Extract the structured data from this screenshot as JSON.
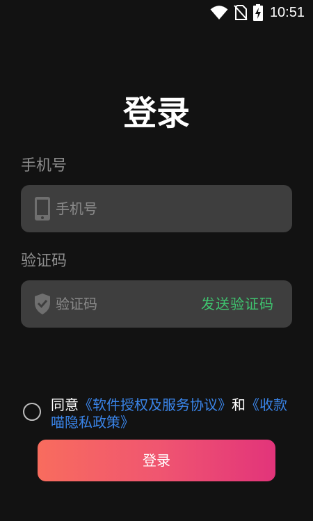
{
  "status_bar": {
    "time": "10:51",
    "icons": [
      "wifi-icon",
      "no-sim-icon",
      "battery-charging-icon"
    ]
  },
  "login": {
    "title": "登录",
    "phone": {
      "label": "手机号",
      "placeholder": "手机号",
      "value": "",
      "icon": "phone-icon"
    },
    "code": {
      "label": "验证码",
      "placeholder": "验证码",
      "value": "",
      "icon": "shield-check-icon",
      "send_button": "发送验证码"
    },
    "agreement": {
      "checked": false,
      "prefix": "同意",
      "terms_link": "《软件授权及服务协议》",
      "conjunction": "和",
      "privacy_link": "《收款喵隐私政策》"
    },
    "submit_label": "登录"
  },
  "colors": {
    "background": "#121212",
    "field_background": "#3e3e3e",
    "send_code": "#3fc46f",
    "link": "#3a85ea",
    "button_gradient": [
      "#f86c5e",
      "#e2347a"
    ]
  }
}
